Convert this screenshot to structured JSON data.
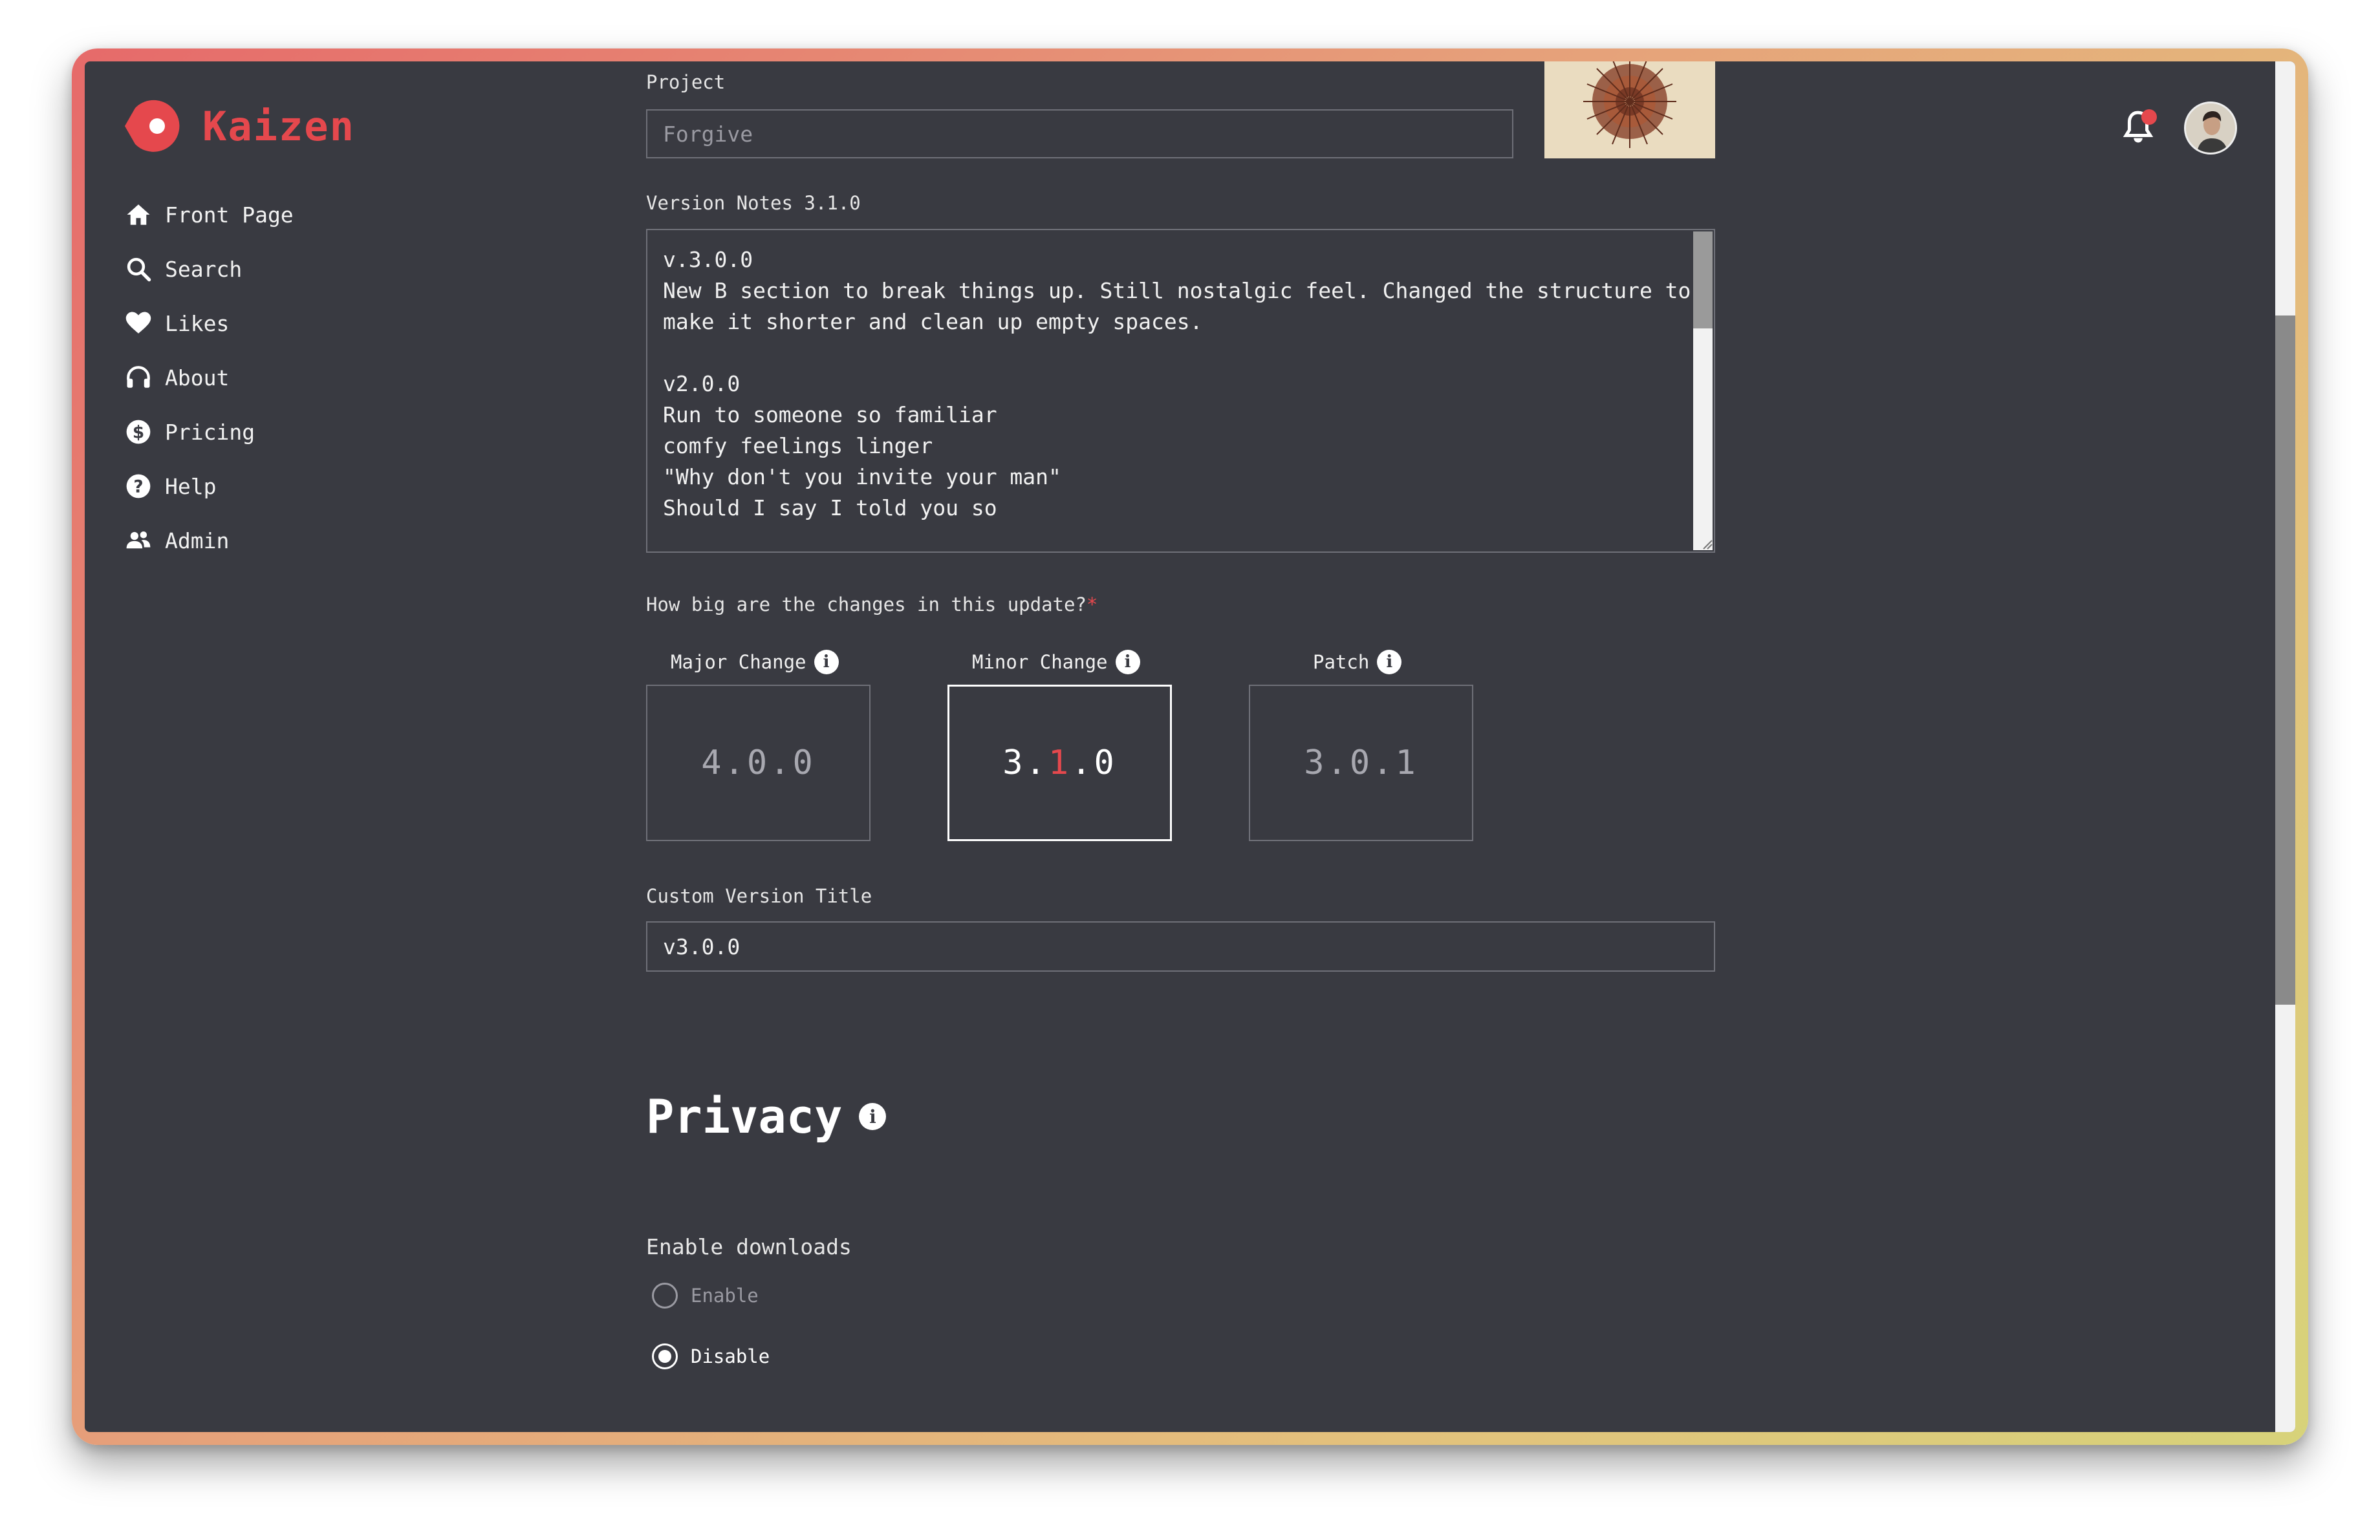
{
  "app": {
    "name": "Kaizen",
    "brand_color": "#e5484d"
  },
  "sidebar": {
    "items": [
      {
        "label": "Front Page",
        "icon": "home-icon"
      },
      {
        "label": "Search",
        "icon": "search-icon"
      },
      {
        "label": "Likes",
        "icon": "heart-icon"
      },
      {
        "label": "About",
        "icon": "headphones-icon"
      },
      {
        "label": "Pricing",
        "icon": "dollar-icon"
      },
      {
        "label": "Help",
        "icon": "help-icon"
      },
      {
        "label": "Admin",
        "icon": "users-icon"
      }
    ]
  },
  "header": {
    "notification_icon": "bell-icon",
    "has_unread": true,
    "avatar": "user-avatar"
  },
  "form": {
    "project": {
      "label": "Project",
      "placeholder": "Forgive"
    },
    "version_notes": {
      "label": "Version Notes 3.1.0",
      "value": "v.3.0.0\nNew B section to break things up. Still nostalgic feel. Changed the structure to\nmake it shorter and clean up empty spaces.\n\nv2.0.0\nRun to someone so familiar\ncomfy feelings linger\n\"Why don't you invite your man\"\nShould I say I told you so"
    },
    "change_size": {
      "question": "How big are the changes in this update?",
      "required_mark": "*",
      "options": [
        {
          "label": "Major Change",
          "version": [
            "4",
            ".",
            "0",
            ".",
            "0"
          ],
          "selected": false
        },
        {
          "label": "Minor Change",
          "version": [
            "3",
            ".",
            "1",
            ".",
            "0"
          ],
          "selected": true
        },
        {
          "label": "Patch",
          "version": [
            "3",
            ".",
            "0",
            ".",
            "1"
          ],
          "selected": false
        }
      ]
    },
    "custom_title": {
      "label": "Custom Version Title",
      "value": "v3.0.0"
    }
  },
  "privacy": {
    "title": "Privacy",
    "downloads": {
      "label": "Enable downloads",
      "options": [
        {
          "label": "Enable",
          "selected": false
        },
        {
          "label": "Disable",
          "selected": true
        }
      ]
    }
  }
}
